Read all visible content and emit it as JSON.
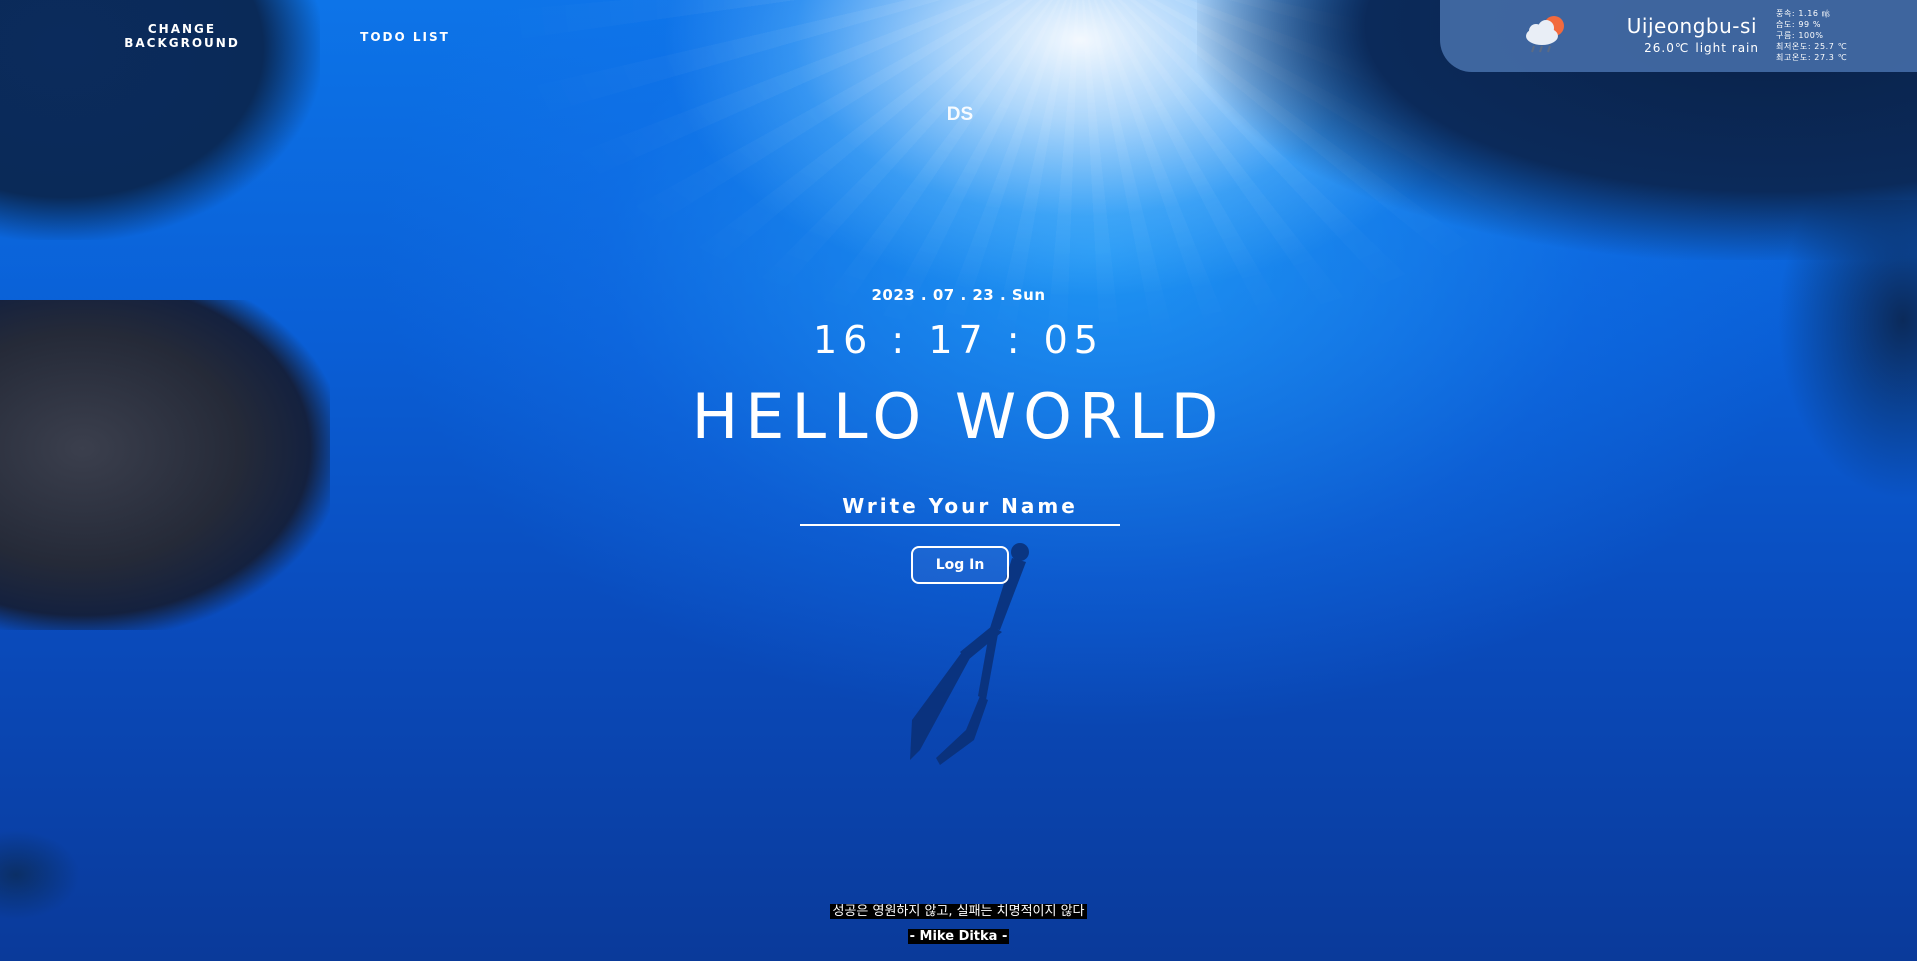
{
  "nav": {
    "change_background": "CHANGE BACKGROUND",
    "todo_list": "TODO LIST"
  },
  "logo": "DS",
  "weather": {
    "icon": "cloud-rain-sun-icon",
    "city": "Uijeongbu-si",
    "temperature": "26.0℃",
    "description": "light rain",
    "details": [
      "풍속: 1.16 ㎧",
      "습도: 99 %",
      "구름: 100%",
      "최저온도: 25.7 ℃",
      "최고온도: 27.3 ℃"
    ],
    "panel_color": "#466eaa"
  },
  "date": "2023 . 07 . 23 . Sun",
  "clock": "16 : 17 : 05",
  "greeting": "HELLO WORLD",
  "login": {
    "placeholder": "Write Your Name",
    "value": "",
    "button": "Log In"
  },
  "quote": {
    "text": "성공은 영원하지 않고, 실패는 치명적이지 않다",
    "author": "- Mike Ditka -"
  },
  "colors": {
    "text": "#ffffff",
    "sky_blue": "#0d74e8",
    "deep_blue": "#0a3a9a"
  }
}
